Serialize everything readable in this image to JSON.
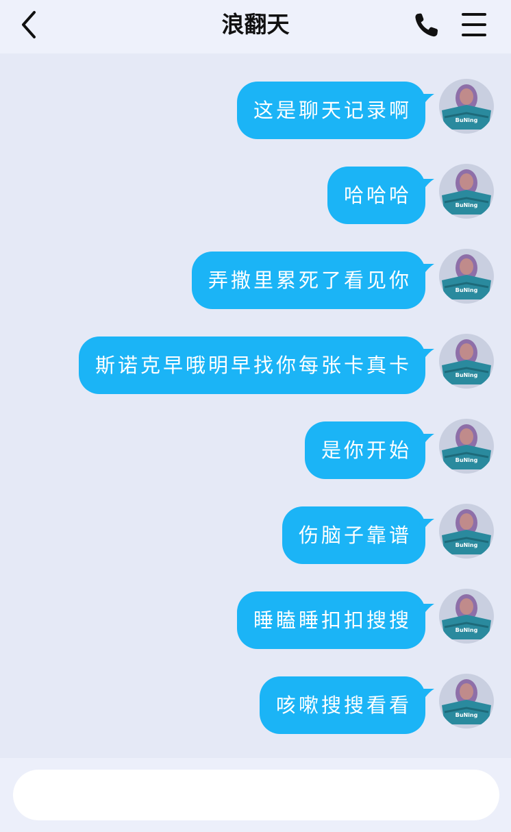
{
  "header": {
    "title": "浪翻天",
    "back_icon": "chevron-left-icon",
    "call_icon": "phone-icon",
    "menu_icon": "hamburger-menu-icon"
  },
  "messages": [
    {
      "text": "这是聊天记录啊",
      "sender": "self"
    },
    {
      "text": "哈哈哈",
      "sender": "self"
    },
    {
      "text": "弄撒里累死了看见你",
      "sender": "self"
    },
    {
      "text": "斯诺克早哦明早找你每张卡真卡",
      "sender": "self"
    },
    {
      "text": "是你开始",
      "sender": "self"
    },
    {
      "text": "伤脑子靠谱",
      "sender": "self"
    },
    {
      "text": "睡瞌睡扣扣搜搜",
      "sender": "self"
    },
    {
      "text": "咳嗽搜搜看看",
      "sender": "self"
    }
  ],
  "avatar": {
    "label": "BuNing",
    "colors": {
      "accent": "#2a8a9e",
      "hair": "#8e6fa8",
      "bg": "#c9cfe0"
    }
  },
  "input": {
    "value": "",
    "placeholder": ""
  },
  "colors": {
    "bubble": "#1bb4f6",
    "background": "#e5e9f6",
    "header": "#eef1fb"
  }
}
